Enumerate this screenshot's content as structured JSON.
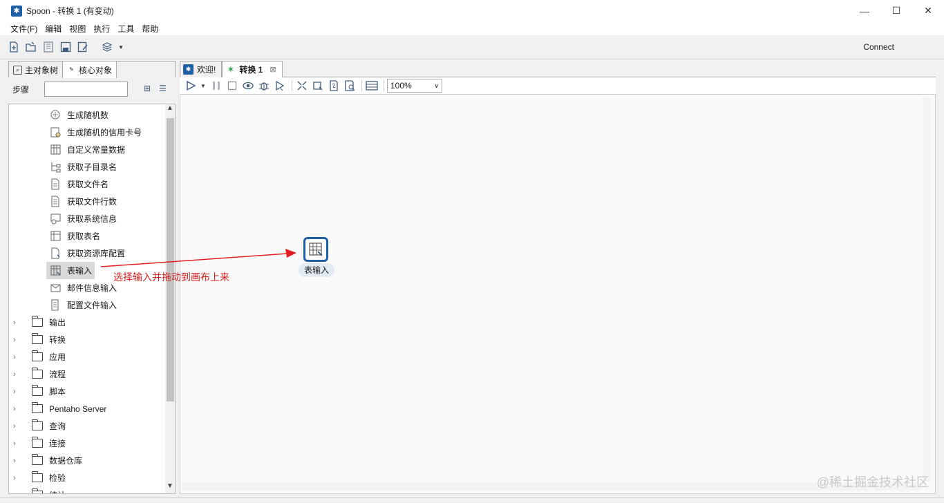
{
  "window": {
    "title": "Spoon - 转换 1 (有变动)",
    "minimize_label": "—",
    "maximize_label": "☐",
    "close_label": "✕"
  },
  "menu": [
    "文件(F)",
    "编辑",
    "视图",
    "执行",
    "工具",
    "帮助"
  ],
  "toolbar": {
    "icons": [
      "new-file-icon",
      "open-file-icon",
      "explore-repository-icon",
      "save-icon",
      "save-as-icon",
      "layers-icon"
    ],
    "connect_label": "Connect"
  },
  "left_panel": {
    "tabs": [
      {
        "label": "主对象树",
        "icon": "search-icon"
      },
      {
        "label": "核心对象",
        "icon": "pencil-icon"
      }
    ],
    "steps_label": "步骤",
    "search_value": "",
    "leaves": [
      {
        "label": "生成随机数",
        "icon": "random-number-icon"
      },
      {
        "label": "生成随机的信用卡号",
        "icon": "random-card-icon"
      },
      {
        "label": "自定义常量数据",
        "icon": "table-icon"
      },
      {
        "label": "获取子目录名",
        "icon": "subdir-icon"
      },
      {
        "label": "获取文件名",
        "icon": "file-icon"
      },
      {
        "label": "获取文件行数",
        "icon": "file-rows-icon"
      },
      {
        "label": "获取系统信息",
        "icon": "system-info-icon"
      },
      {
        "label": "获取表名",
        "icon": "table-name-icon"
      },
      {
        "label": "获取资源库配置",
        "icon": "repository-config-icon"
      },
      {
        "label": "表输入",
        "icon": "table-input-icon"
      },
      {
        "label": "邮件信息输入",
        "icon": "mail-icon"
      },
      {
        "label": "配置文件输入",
        "icon": "config-file-icon"
      }
    ],
    "folders": [
      "输出",
      "转换",
      "应用",
      "流程",
      "脚本",
      "Pentaho Server",
      "查询",
      "连接",
      "数据仓库",
      "检验",
      "统计"
    ]
  },
  "editor_tabs": [
    {
      "label": "欢迎!",
      "icon": "spoon-icon",
      "active": false
    },
    {
      "label": "转换 1",
      "icon": "transform-icon",
      "active": true,
      "close": "⊠"
    }
  ],
  "canvas_toolbar": {
    "icons": [
      "run-icon",
      "run-dropdown-icon",
      "pause-icon",
      "stop-icon",
      "preview-icon",
      "debug-icon",
      "replay-icon",
      "verify-icon",
      "impact-icon",
      "sql-icon",
      "explore-db-icon",
      "show-results-icon"
    ],
    "zoom": "100%"
  },
  "canvas": {
    "step_label": "表输入",
    "annotation": "选择输入并拖动到画布上来"
  },
  "watermark": "@稀土掘金技术社区",
  "colors": {
    "accent": "#1f5fa6",
    "annotation": "#d41f1f",
    "canvas_bg": "#fafafa"
  }
}
